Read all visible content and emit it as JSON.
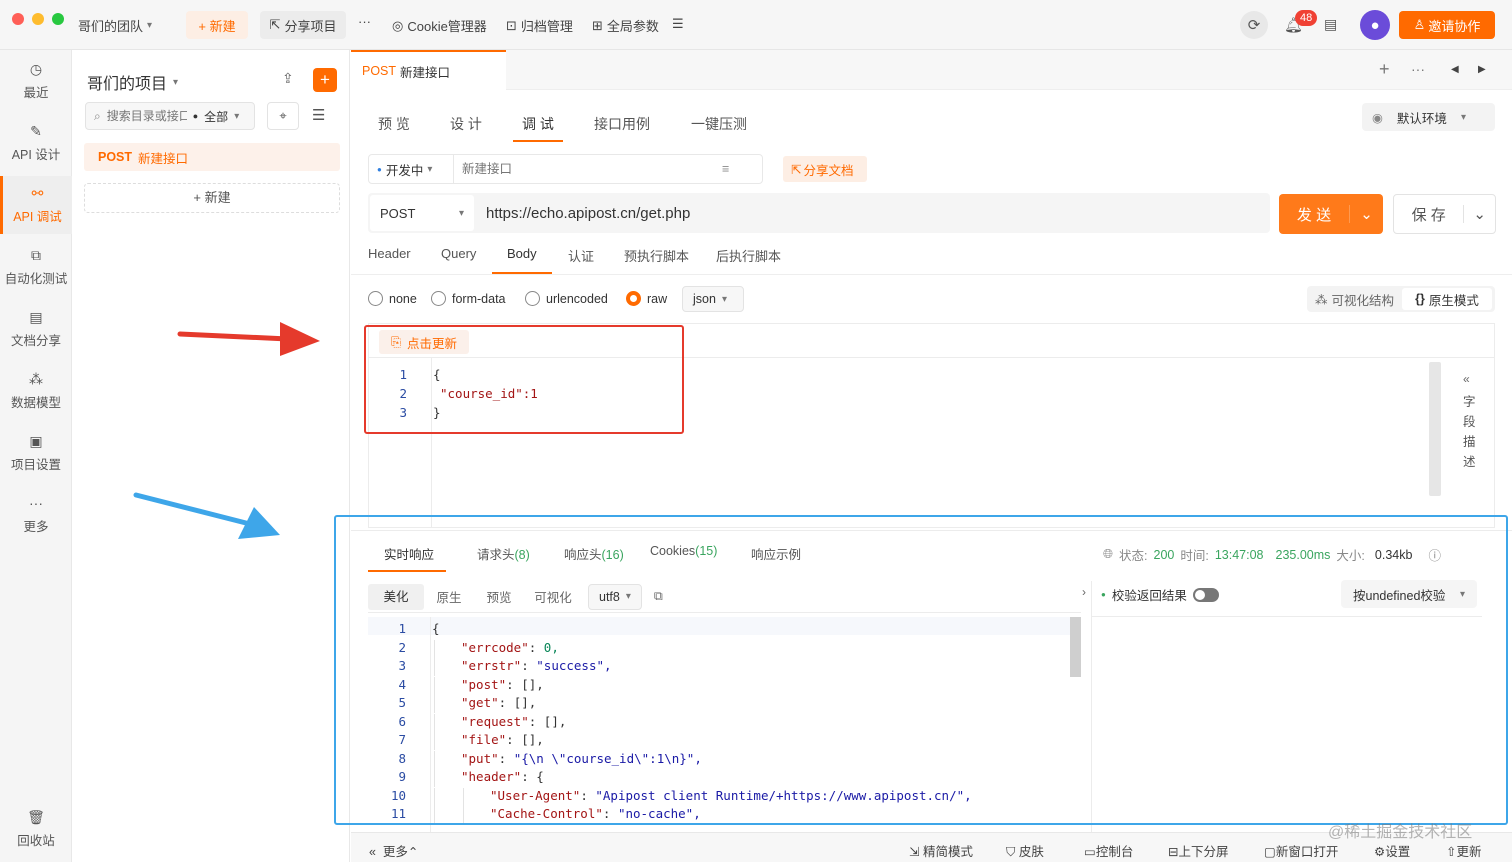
{
  "topbar": {
    "team": "哥们的团队",
    "new_label": "+ 新建",
    "share_project": "分享项目",
    "more": "···",
    "cookie_manager": "Cookie管理器",
    "archive": "归档管理",
    "global_params": "全局参数",
    "notif_count": "48",
    "invite": "邀请协作"
  },
  "nav": [
    {
      "label": "最近",
      "icon": "history-icon"
    },
    {
      "label": "API 设计",
      "icon": "edit-icon"
    },
    {
      "label": "API 调试",
      "icon": "link-icon"
    },
    {
      "label": "自动化测试",
      "icon": "flow-icon"
    },
    {
      "label": "文档分享",
      "icon": "doc-icon"
    },
    {
      "label": "数据模型",
      "icon": "model-icon"
    },
    {
      "label": "项目设置",
      "icon": "folder-gear-icon"
    },
    {
      "label": "更多",
      "icon": "more-icon"
    }
  ],
  "nav_bottom": {
    "label": "回收站"
  },
  "project": {
    "title": "哥们的项目",
    "search_placeholder": "搜索目录或接口",
    "filter": "全部",
    "item_method": "POST",
    "item_name": "新建接口",
    "new_btn": "+ 新建"
  },
  "request_tab": {
    "method": "POST",
    "name": "新建接口"
  },
  "subtabs": [
    "预 览",
    "设 计",
    "调 试",
    "接口用例",
    "一键压测"
  ],
  "env": "默认环境",
  "status_select": "开发中",
  "name_placeholder": "新建接口",
  "share_doc": "分享文档",
  "method": "POST",
  "url": "https://echo.apipost.cn/get.php",
  "send": "发 送",
  "save": "保 存",
  "param_tabs": [
    "Header",
    "Query",
    "Body",
    "认证",
    "预执行脚本",
    "后执行脚本"
  ],
  "body_types": [
    "none",
    "form-data",
    "urlencoded",
    "raw"
  ],
  "body_format": "json",
  "view_visual": "可视化结构",
  "view_raw": "原生模式",
  "click_update": "点击更新",
  "req_code": [
    "{",
    "\"course_id\":1",
    "}"
  ],
  "field_desc": [
    "字",
    "段",
    "描",
    "述"
  ],
  "resp_tabs": [
    "实时响应",
    "请求头",
    "(8)",
    "响应头",
    "(16)",
    "Cookies",
    "(15)",
    "响应示例"
  ],
  "resp_meta": {
    "status_label": "状态:",
    "status": "200",
    "time_label": "时间:",
    "time": "13:47:08",
    "duration": "235.00ms",
    "size_label": "大小:",
    "size": "0.34kb"
  },
  "resp_view_tabs": [
    "美化",
    "原生",
    "预览",
    "可视化"
  ],
  "encoding": "utf8",
  "validate_label": "校验返回结果",
  "validate_select": "按undefined校验",
  "resp_lines": [
    {
      "n": "1",
      "t": "{"
    },
    {
      "n": "2",
      "k": "\"errcode\"",
      "v": "0,",
      "vt": "num",
      "i": 1
    },
    {
      "n": "3",
      "k": "\"errstr\"",
      "v": "\"success\",",
      "vt": "str",
      "i": 1
    },
    {
      "n": "4",
      "k": "\"post\"",
      "v": "[],",
      "vt": "plain",
      "i": 1
    },
    {
      "n": "5",
      "k": "\"get\"",
      "v": "[],",
      "vt": "plain",
      "i": 1
    },
    {
      "n": "6",
      "k": "\"request\"",
      "v": "[],",
      "vt": "plain",
      "i": 1
    },
    {
      "n": "7",
      "k": "\"file\"",
      "v": "[],",
      "vt": "plain",
      "i": 1
    },
    {
      "n": "8",
      "k": "\"put\"",
      "v": "\"{\\n \\\"course_id\\\":1\\n}\",",
      "vt": "str",
      "i": 1
    },
    {
      "n": "9",
      "k": "\"header\"",
      "v": "{",
      "vt": "plain",
      "i": 1
    },
    {
      "n": "10",
      "k": "\"User-Agent\"",
      "v": "\"Apipost client Runtime/+https://www.apipost.cn/\",",
      "vt": "str",
      "i": 2
    },
    {
      "n": "11",
      "k": "\"Cache-Control\"",
      "v": "\"no-cache\",",
      "vt": "str",
      "i": 2
    }
  ],
  "statusbar": {
    "more": "更多",
    "simple": "精简模式",
    "skin": "皮肤",
    "console": "控制台",
    "split": "上下分屏",
    "new_window": "新窗口打开",
    "settings": "设置",
    "update": "更新"
  },
  "watermark": "@稀土掘金技术社区",
  "colors": {
    "accent": "#ff6a00",
    "red_annotation": "#e53a2c",
    "blue_annotation": "#3ea6e9"
  }
}
